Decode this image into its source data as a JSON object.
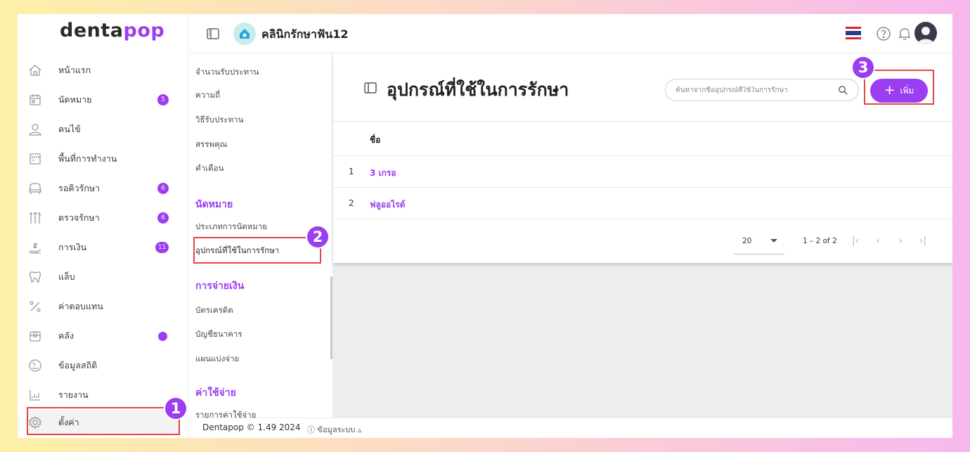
{
  "brand": {
    "logo_a": "denta",
    "logo_b": "pop"
  },
  "colors": {
    "accent": "#9b3df0",
    "highlight": "#e24646"
  },
  "sidebar": {
    "items": [
      {
        "label": "หน้าแรก",
        "icon": "home-icon"
      },
      {
        "label": "นัดหมาย",
        "icon": "calendar-icon",
        "badge": "5"
      },
      {
        "label": "คนไข้",
        "icon": "user-icon"
      },
      {
        "label": "พื้นที่การทำงาน",
        "icon": "workspace-icon"
      },
      {
        "label": "รอคิวรักษา",
        "icon": "dental-chair-icon",
        "badge": "6"
      },
      {
        "label": "ตรวจรักษา",
        "icon": "dental-tools-icon",
        "badge": "6"
      },
      {
        "label": "การเงิน",
        "icon": "money-hand-icon",
        "badge": "11"
      },
      {
        "label": "แล็บ",
        "icon": "tooth-icon"
      },
      {
        "label": "ค่าตอบแทน",
        "icon": "percent-icon"
      },
      {
        "label": "คลัง",
        "icon": "box-icon",
        "dot": true
      },
      {
        "label": "ข้อมูลสถิติ",
        "icon": "gauge-icon"
      },
      {
        "label": "รายงาน",
        "icon": "report-chart-icon"
      },
      {
        "label": "ตั้งค่า",
        "icon": "gear-icon"
      }
    ]
  },
  "topbar": {
    "clinic_name": "คลินิกรักษาฟัน12"
  },
  "submenu": {
    "items_top": [
      "จำนวนรับประทาน",
      "ความถี่",
      "วิธีรับประทาน",
      "สรรพคุณ",
      "คำเตือน"
    ],
    "section_appointment": "นัดหมาย",
    "appointment_items": [
      "ประเภทการนัดหมาย",
      "อุปกรณ์ที่ใช้ในการรักษา"
    ],
    "section_payment": "การจ่ายเงิน",
    "payment_items": [
      "บัตรเครดิต",
      "บัญชีธนาคาร",
      "แผนแบ่งจ่าย"
    ],
    "section_expense": "ค่าใช้จ่าย",
    "expense_items": [
      "รายการค่าใช้จ่าย"
    ]
  },
  "main": {
    "title": "อุปกรณ์ที่ใช้ในการรักษา",
    "search_placeholder": "ค้นหาจากชื่ออุปกรณ์ที่ใช้ในการรักษา",
    "add_label": "เพิ่ม",
    "column_name": "ชื่อ",
    "rows": [
      {
        "index": "1",
        "name": "3 เกรอ"
      },
      {
        "index": "2",
        "name": "ฟลูออไรด์"
      }
    ],
    "pager": {
      "page_size": "20",
      "range": "1 – 2 of 2"
    }
  },
  "steps": [
    "1",
    "2",
    "3"
  ],
  "footer": {
    "version": "Dentapop © 1.49 2024",
    "info": "ⓘ ข้อมูลระบบ ▵"
  }
}
